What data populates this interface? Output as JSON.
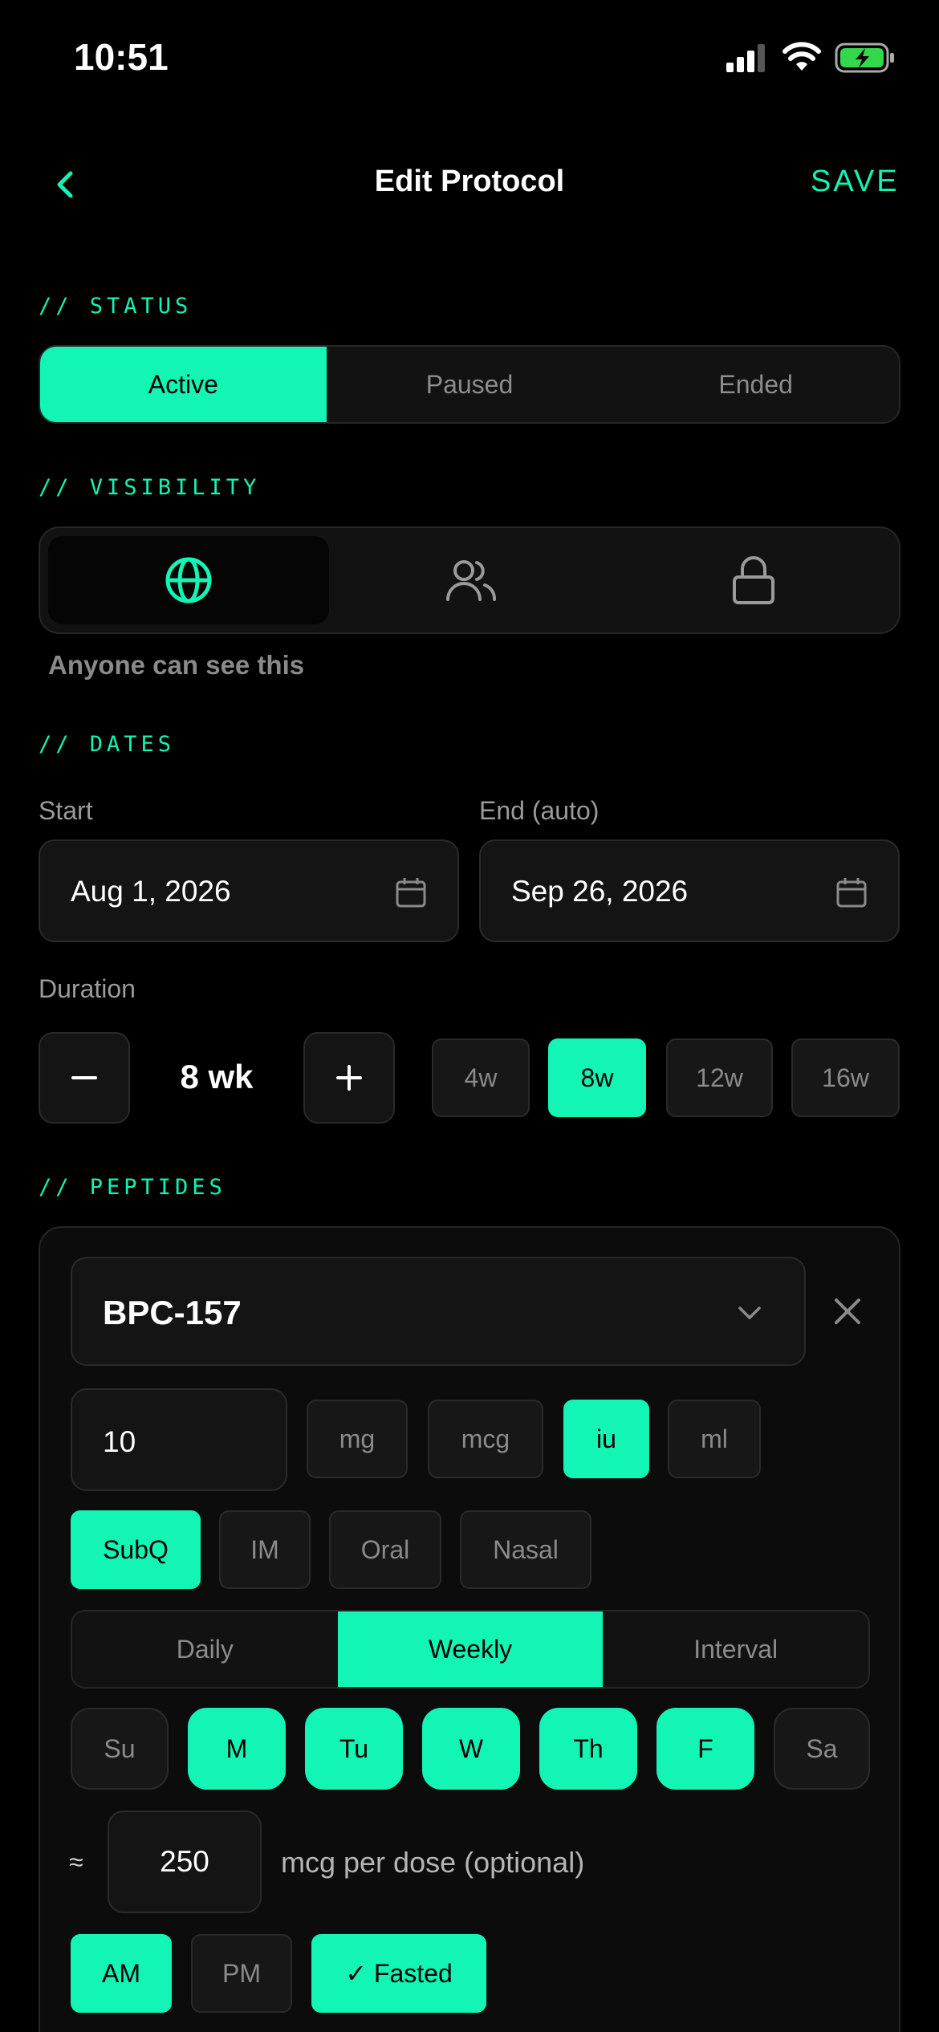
{
  "status_bar": {
    "time": "10:51"
  },
  "nav": {
    "title": "Edit Protocol",
    "save_label": "SAVE"
  },
  "status": {
    "section_label": "// STATUS",
    "options": [
      "Active",
      "Paused",
      "Ended"
    ],
    "selected": "Active"
  },
  "visibility": {
    "section_label": "// VISIBILITY",
    "options": [
      "globe-icon",
      "users-icon",
      "lock-icon"
    ],
    "selected": "globe-icon",
    "caption": "Anyone can see this"
  },
  "dates": {
    "section_label": "// DATES",
    "start_label": "Start",
    "start_value": "Aug 1, 2026",
    "end_label": "End (auto)",
    "end_value": "Sep 26, 2026",
    "duration_label": "Duration",
    "duration_value": "8 wk",
    "presets": [
      "4w",
      "8w",
      "12w",
      "16w"
    ],
    "selected_preset": "8w"
  },
  "peptides": {
    "section_label": "// PEPTIDES",
    "name": "BPC-157",
    "amount": "10",
    "units": [
      "mg",
      "mcg",
      "iu",
      "ml"
    ],
    "selected_unit": "iu",
    "routes": [
      "SubQ",
      "IM",
      "Oral",
      "Nasal"
    ],
    "selected_route": "SubQ",
    "frequency": [
      "Daily",
      "Weekly",
      "Interval"
    ],
    "selected_frequency": "Weekly",
    "days": [
      "Su",
      "M",
      "Tu",
      "W",
      "Th",
      "F",
      "Sa"
    ],
    "selected_days": [
      "M",
      "Tu",
      "W",
      "Th",
      "F"
    ],
    "approx_symbol": "≈",
    "dose_value": "250",
    "dose_suffix": "mcg per dose (optional)",
    "timing": [
      "AM",
      "PM",
      "✓ Fasted"
    ],
    "selected_timing": [
      "AM",
      "✓ Fasted"
    ]
  },
  "colors": {
    "accent": "#12F5B5",
    "background": "#000000"
  }
}
